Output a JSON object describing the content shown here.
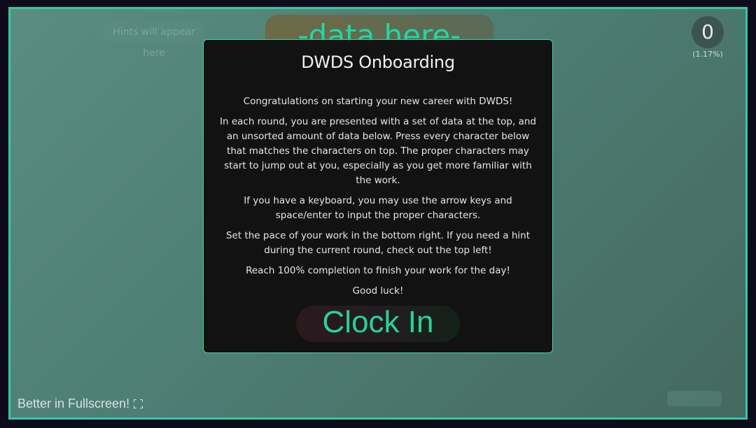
{
  "game": {
    "hint_text": "Hints will appear here",
    "top_data": "-data here-",
    "score": "0",
    "score_percent": "(1.17%)",
    "fullscreen_label": "Better in Fullscreen!",
    "accent_color": "#33c9a3"
  },
  "modal": {
    "title": "DWDS Onboarding",
    "paragraphs": [
      "Congratulations on starting your new career with DWDS!",
      "In each round, you are presented with a set of data at the top, and an unsorted amount of data below. Press every character below that matches the characters on top. The proper characters may start to jump out at you, especially as you get more familiar with the work.",
      "If you have a keyboard, you may use the arrow keys and space/enter to input the proper characters.",
      "Set the pace of your work in the bottom right. If you need a hint during the current round, check out the top left!",
      "Reach 100% completion to finish your work for the day!",
      "Good luck!"
    ],
    "button_label": "Clock In"
  },
  "icons": {
    "fullscreen": "fullscreen-icon"
  }
}
